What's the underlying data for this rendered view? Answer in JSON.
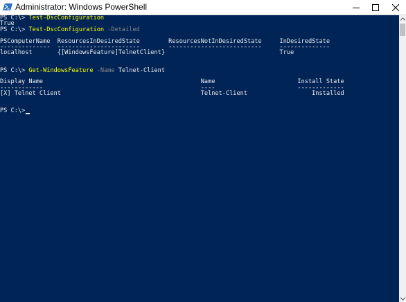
{
  "window": {
    "title": "Administrator: Windows PowerShell",
    "colors": {
      "background": "#012456",
      "text": "#eeedf0",
      "command": "#ffff00",
      "parameter": "#8a8a8a"
    }
  },
  "console": {
    "lines": [
      {
        "prompt": "PS C:\\> ",
        "command": "Test-DscConfiguration"
      },
      {
        "output": "True"
      },
      {
        "prompt": "PS C:\\> ",
        "command": "Test-DscConfiguration",
        "parameter": " -Detailed"
      },
      {
        "output": ""
      },
      {
        "output": "PSComputerName  ResourcesInDesiredState        ResourcesNotInDesiredState     InDesiredState"
      },
      {
        "output": "--------------  -----------------------        --------------------------     --------------"
      },
      {
        "output": "localhost       {[WindowsFeature]TelnetClient}                                True"
      },
      {
        "output": ""
      },
      {
        "output": ""
      },
      {
        "prompt": "PS C:\\> ",
        "command": "Get-WindowsFeature",
        "parameter": " -Name",
        "argument": " Telnet-Client"
      },
      {
        "output": ""
      },
      {
        "output": "Display Name                                            Name                       Install State"
      },
      {
        "output": "------------                                            ----                       -------------"
      },
      {
        "output": "[X] Telnet Client                                       Telnet-Client                  Installed"
      },
      {
        "output": ""
      },
      {
        "output": ""
      },
      {
        "prompt": "PS C:\\> "
      }
    ]
  }
}
